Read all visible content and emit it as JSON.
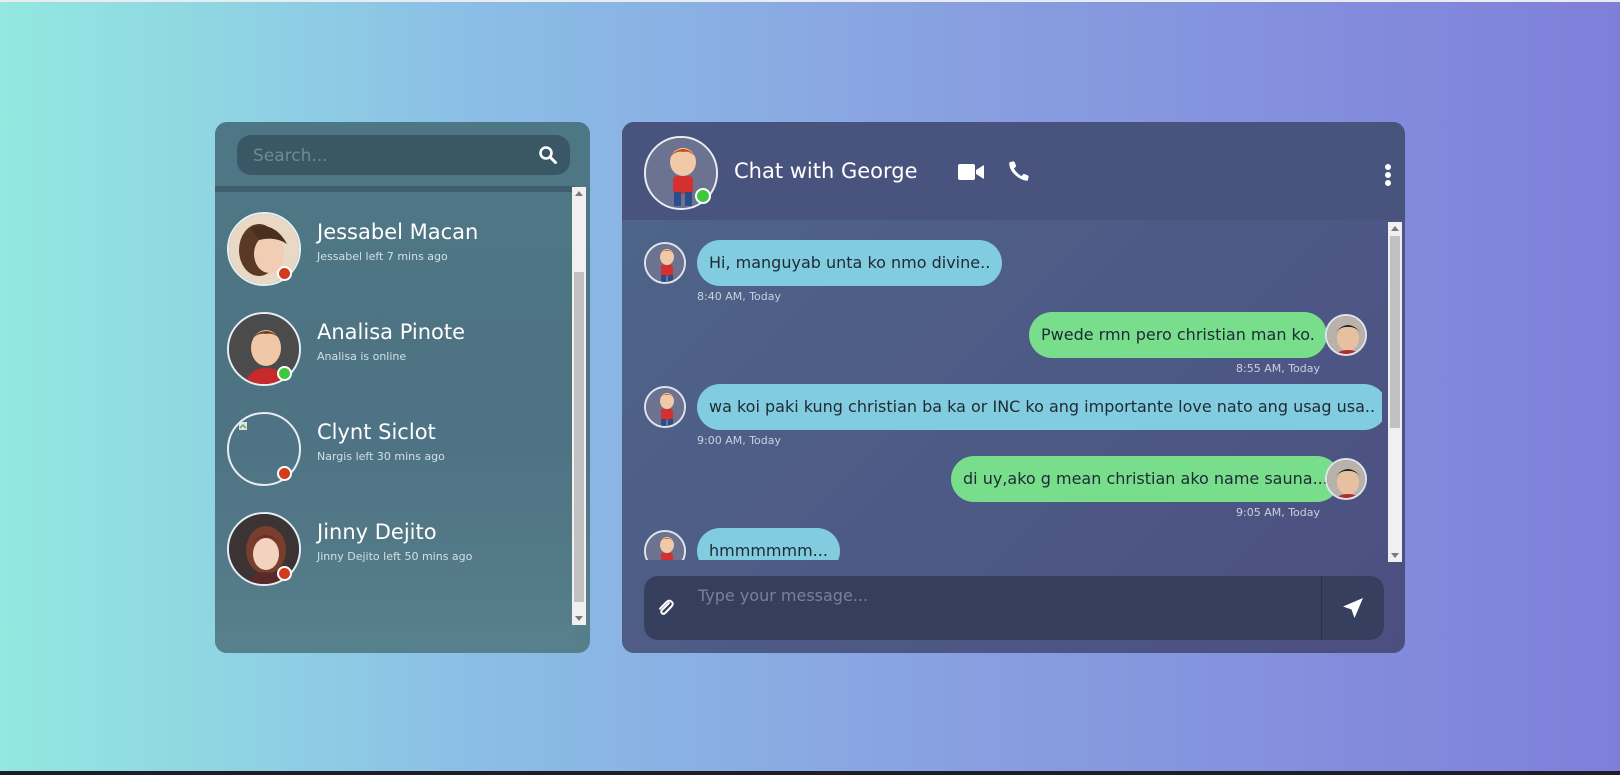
{
  "search": {
    "placeholder": "Search..."
  },
  "contacts": [
    {
      "name": "Jessabel Macan",
      "status_text": "Jessabel left 7 mins ago",
      "status": "offline",
      "avatar": "woman-photo"
    },
    {
      "name": "Analisa Pinote",
      "status_text": "Analisa is online",
      "status": "online",
      "avatar": "cartoon-boy"
    },
    {
      "name": "Clynt Siclot",
      "status_text": "Nargis left 30 mins ago",
      "status": "offline",
      "avatar": "broken-image"
    },
    {
      "name": "Jinny Dejito",
      "status_text": "Jinny Dejito left 50 mins ago",
      "status": "offline",
      "avatar": "cartoon-girl"
    }
  ],
  "chat": {
    "title": "Chat with George",
    "messages": [
      {
        "side": "in",
        "text": "Hi, manguyab unta ko nmo divine..",
        "time": "8:40 AM, Today"
      },
      {
        "side": "out",
        "text": "Pwede rmn pero christian man ko.",
        "time": "8:55 AM, Today"
      },
      {
        "side": "in",
        "text": "wa koi paki kung christian ba ka or INC ko ang importante love nato ang usag usa..",
        "time": "9:00 AM, Today"
      },
      {
        "side": "out",
        "text": "di uy,ako g mean christian ako name sauna...",
        "time": "9:05 AM, Today"
      },
      {
        "side": "in",
        "text": "hmmmmmm...",
        "time": ""
      }
    ],
    "composer_placeholder": "Type your message..."
  },
  "colors": {
    "online": "#3ec83e",
    "offline": "#d23c1c",
    "incoming_bubble": "#82ccdf",
    "outgoing_bubble": "#78de8c"
  },
  "icons": [
    "search-icon",
    "video-camera-icon",
    "phone-icon",
    "more-vertical-icon",
    "paperclip-icon",
    "send-icon"
  ]
}
